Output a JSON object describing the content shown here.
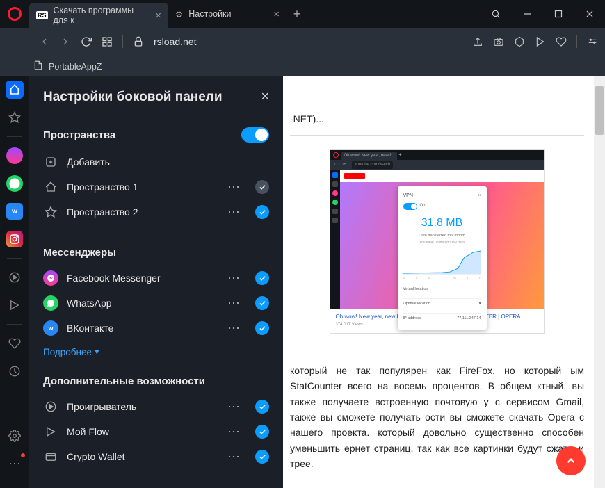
{
  "titlebar": {
    "tabs": [
      {
        "icon": "RS",
        "label": "Скачать программы для к",
        "active": true
      },
      {
        "icon": "gear",
        "label": "Настройки",
        "active": false
      }
    ]
  },
  "addressbar": {
    "url": "rsload.net"
  },
  "bookmarks": {
    "items": [
      {
        "label": "PortableAppZ"
      }
    ]
  },
  "panel": {
    "title": "Настройки боковой панели",
    "sections": {
      "spaces": {
        "title": "Пространства",
        "toggle": true,
        "items": [
          {
            "icon": "plus",
            "label": "Добавить",
            "check": null
          },
          {
            "icon": "home",
            "label": "Пространство 1",
            "check": "gray"
          },
          {
            "icon": "star",
            "label": "Пространство 2",
            "check": "blue"
          }
        ]
      },
      "messengers": {
        "title": "Мессенджеры",
        "items": [
          {
            "icon": "fb",
            "label": "Facebook Messenger",
            "check": "blue"
          },
          {
            "icon": "wa",
            "label": "WhatsApp",
            "check": "blue"
          },
          {
            "icon": "vk",
            "label": "ВКонтакте",
            "check": "blue"
          }
        ],
        "more": "Подробнее"
      },
      "extra": {
        "title": "Дополнительные возможности",
        "items": [
          {
            "icon": "play",
            "label": "Проигрыватель",
            "check": "blue"
          },
          {
            "icon": "flow",
            "label": "Мой Flow",
            "check": "blue"
          },
          {
            "icon": "wallet",
            "label": "Crypto Wallet",
            "check": "blue"
          }
        ]
      }
    }
  },
  "content": {
    "frag_net": "-NET)...",
    "shot": {
      "tab": "Oh wow! New year, new b",
      "addr": "youtube.com/watch",
      "vpn": {
        "label_vpn": "VPN",
        "label_on": "On",
        "big": "31.8 MB",
        "sub": "Data transferred this month",
        "sub2": "You have unlimited VPN data",
        "axis": [
          "S",
          "S",
          "M",
          "T",
          "W",
          "T",
          "F"
        ],
        "f1_l": "Virtual location",
        "f2_l": "Optimal location",
        "f3_l": "IP address",
        "f3_r": "77.111.247.14"
      },
      "caption": "Oh wow! New year, new browser | BROWSER FOR COMPUTER | OPERA",
      "views": "374 017 Views"
    },
    "para": " который не так популярен как FireFox, но который ым StatCounter всего на восемь процентов. В общем ктный, вы также получаете встроенную почтовую у с сервисом Gmail, также вы сможете получать ости вы сможете скачать Opera с нашего проекта. который довольно существенно способен уменьшить ернет страниц, так как все картинки будут сжаты и трее."
  },
  "chart_data": {
    "type": "area",
    "title": "Data transferred this month",
    "categories": [
      "S",
      "S",
      "M",
      "T",
      "W",
      "T",
      "F"
    ],
    "values": [
      0,
      0,
      0,
      1,
      4,
      28,
      31.8
    ],
    "ylabel": "MB",
    "ylim": [
      0,
      32
    ]
  }
}
